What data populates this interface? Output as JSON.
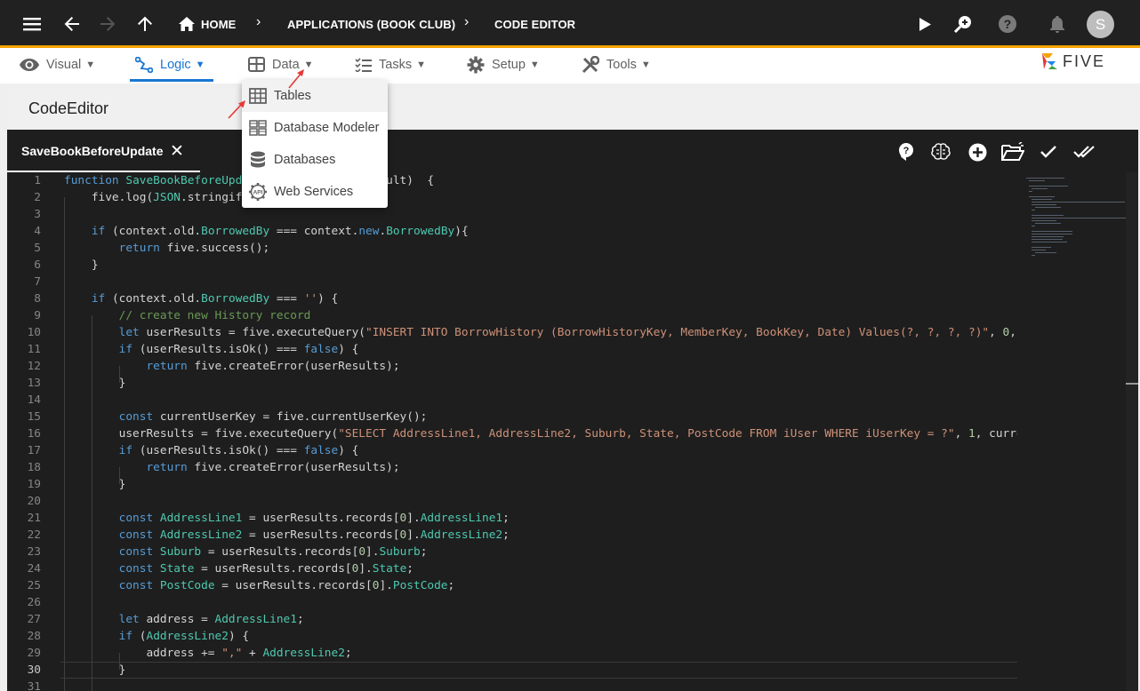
{
  "topbar": {
    "breadcrumb": [
      "HOME",
      "APPLICATIONS (BOOK CLUB)",
      "CODE EDITOR"
    ],
    "avatar_letter": "S"
  },
  "menubar": {
    "items": [
      {
        "label": "Visual",
        "icon": "eye-icon"
      },
      {
        "label": "Logic",
        "icon": "logic-icon",
        "active": true
      },
      {
        "label": "Data",
        "icon": "table-icon"
      },
      {
        "label": "Tasks",
        "icon": "tasks-icon"
      },
      {
        "label": "Setup",
        "icon": "gear-icon"
      },
      {
        "label": "Tools",
        "icon": "tools-icon"
      }
    ],
    "logo": "FIVE"
  },
  "data_menu": {
    "items": [
      {
        "label": "Tables",
        "icon": "table-grid-icon"
      },
      {
        "label": "Database Modeler",
        "icon": "database-modeler-icon"
      },
      {
        "label": "Databases",
        "icon": "database-icon"
      },
      {
        "label": "Web Services",
        "icon": "api-gear-icon"
      }
    ]
  },
  "panel": {
    "title": "CodeEditor"
  },
  "editor": {
    "tab_label": "SaveBookBeforeUpdate",
    "current_line": 30,
    "lines": [
      "function SaveBookBeforeUpd                    sult)  {",
      "    five.log(JSON.stringif",
      "",
      "    if (context.old.BorrowedBy === context.new.BorrowedBy){",
      "        return five.success();",
      "    }",
      "",
      "    if (context.old.BorrowedBy === '') {",
      "        // create new History record",
      "        let userResults = five.executeQuery(\"INSERT INTO BorrowHistory (BorrowHistoryKey, MemberKey, BookKey, Date) Values(?, ?, ?, ?)\", 0,",
      "        if (userResults.isOk() === false) {",
      "            return five.createError(userResults);",
      "        }",
      "",
      "        const currentUserKey = five.currentUserKey();",
      "        userResults = five.executeQuery(\"SELECT AddressLine1, AddressLine2, Suburb, State, PostCode FROM iUser WHERE iUserKey = ?\", 1, curre",
      "        if (userResults.isOk() === false) {",
      "            return five.createError(userResults);",
      "        }",
      "",
      "        const AddressLine1 = userResults.records[0].AddressLine1;",
      "        const AddressLine2 = userResults.records[0].AddressLine2;",
      "        const Suburb = userResults.records[0].Suburb;",
      "        const State = userResults.records[0].State;",
      "        const PostCode = userResults.records[0].PostCode;",
      "",
      "        let address = AddressLine1;",
      "        if (AddressLine2) {",
      "            address += \",\" + AddressLine2;",
      "        }",
      ""
    ]
  }
}
